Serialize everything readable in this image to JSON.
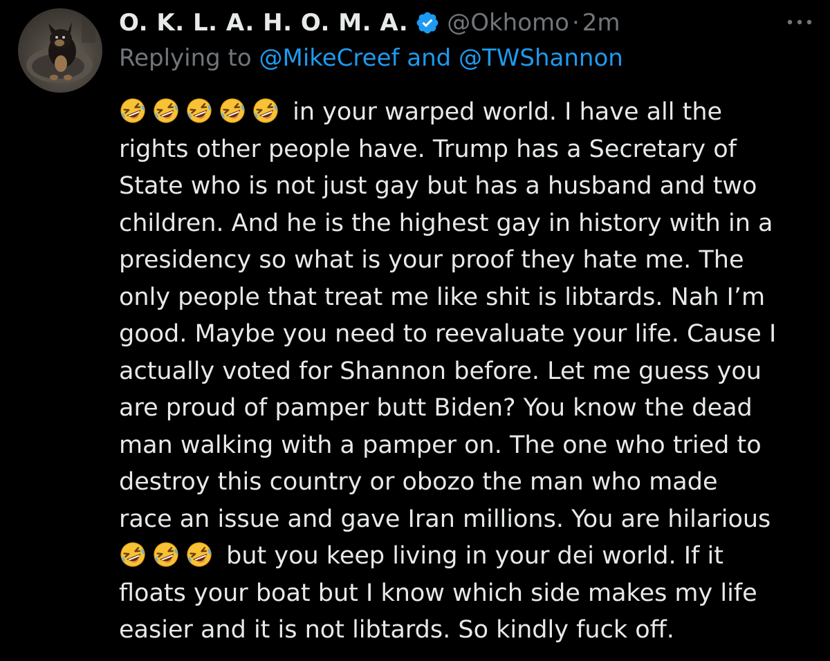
{
  "tweet": {
    "author": {
      "display_name": "O. K. L. A. H. O. M. A.",
      "handle": "@Okhomo",
      "separator": "·",
      "time": "2m",
      "verified": true,
      "avatar": "dog-avatar"
    },
    "reply": {
      "prefix": "Replying to ",
      "mentions": "@MikeCreef and @TWShannon"
    },
    "more_icon": "more-horizontal-icon",
    "emoji": "rolling-on-floor-laughing-emoji",
    "lines": [
      " in your warped world. I have all the",
      "rights other people have. Trump has a Secretary of",
      "State who is not just gay but has a husband and two",
      "children. And he is the highest gay in history with in a",
      "presidency so what is your proof they hate me. The",
      "only people that treat me like shit is libtards. Nah I’m",
      "good. Maybe you need to reevaluate your life. Cause I",
      "actually voted for Shannon before. Let me guess you",
      "are proud of pamper butt Biden? You know the dead",
      "man walking with a pamper on. The one who tried to",
      "destroy this country or obozo the man who made",
      "race an issue and gave Iran millions. You are hilarious",
      " but you keep living in your dei world. If it",
      "floats your boat but I know which side makes my life",
      "easier and it is not libtards. So kindly fuck off."
    ],
    "emoji_counts": {
      "line_1": 5,
      "line_13": 3
    }
  },
  "colors": {
    "background": "#000000",
    "text": "#e7e9ea",
    "muted": "#71767b",
    "accent": "#1d9bf0"
  }
}
